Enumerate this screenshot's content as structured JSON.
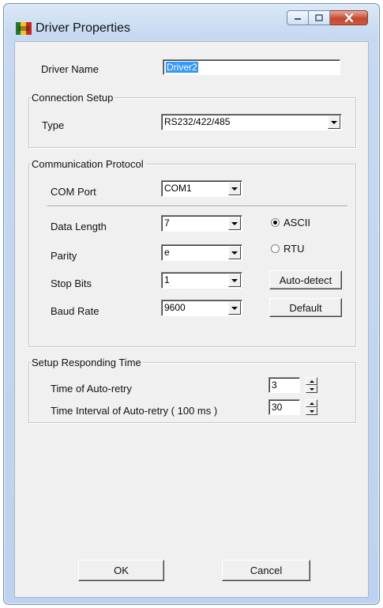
{
  "window": {
    "title": "Driver Properties",
    "icon": "app-flag-icon",
    "controls": [
      "minimize-icon",
      "maximize-icon",
      "close-icon"
    ]
  },
  "driver_name": {
    "label": "Driver Name",
    "value": "Driver2"
  },
  "connection_setup": {
    "legend": "Connection Setup",
    "type_label": "Type",
    "type_value": "RS232/422/485"
  },
  "communication_protocol": {
    "legend": "Communication Protocol",
    "com_port_label": "COM Port",
    "com_port_value": "COM1",
    "data_length_label": "Data Length",
    "data_length_value": "7",
    "parity_label": "Parity",
    "parity_value": "e",
    "stop_bits_label": "Stop Bits",
    "stop_bits_value": "1",
    "baud_rate_label": "Baud Rate",
    "baud_rate_value": "9600",
    "mode_ascii_label": "ASCII",
    "mode_rtu_label": "RTU",
    "selected_mode": "ASCII",
    "auto_detect_label": "Auto-detect",
    "default_label": "Default"
  },
  "responding_time": {
    "legend": "Setup Responding Time",
    "auto_retry_label": "Time of Auto-retry",
    "auto_retry_value": "3",
    "interval_label": "Time Interval of Auto-retry ( 100 ms )",
    "interval_value": "30"
  },
  "footer": {
    "ok_label": "OK",
    "cancel_label": "Cancel"
  }
}
